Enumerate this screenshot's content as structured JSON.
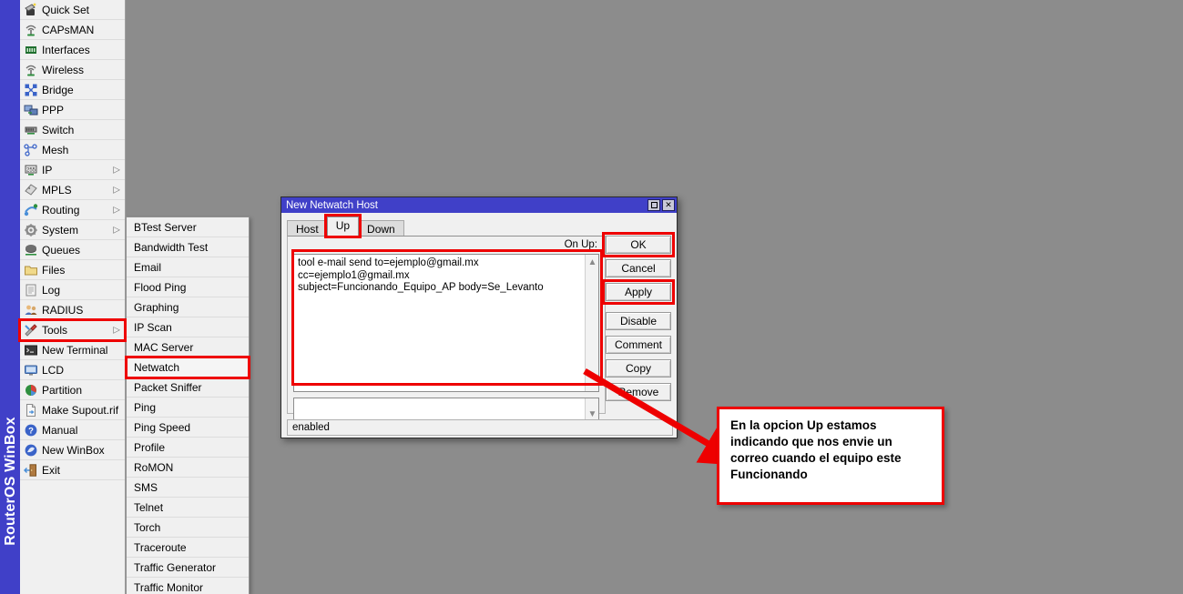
{
  "app": {
    "brand_vertical": "RouterOS WinBox",
    "brand_color": "#4040c8"
  },
  "sidebar": {
    "items": [
      {
        "label": "Quick Set",
        "icon": "quick-set-icon",
        "arrow": false
      },
      {
        "label": "CAPsMAN",
        "icon": "capsman-icon",
        "arrow": false
      },
      {
        "label": "Interfaces",
        "icon": "interfaces-icon",
        "arrow": false
      },
      {
        "label": "Wireless",
        "icon": "wireless-icon",
        "arrow": false
      },
      {
        "label": "Bridge",
        "icon": "bridge-icon",
        "arrow": false
      },
      {
        "label": "PPP",
        "icon": "ppp-icon",
        "arrow": false
      },
      {
        "label": "Switch",
        "icon": "switch-icon",
        "arrow": false
      },
      {
        "label": "Mesh",
        "icon": "mesh-icon",
        "arrow": false
      },
      {
        "label": "IP",
        "icon": "ip-icon",
        "arrow": true
      },
      {
        "label": "MPLS",
        "icon": "mpls-icon",
        "arrow": true
      },
      {
        "label": "Routing",
        "icon": "routing-icon",
        "arrow": true
      },
      {
        "label": "System",
        "icon": "system-gear-icon",
        "arrow": true
      },
      {
        "label": "Queues",
        "icon": "queues-icon",
        "arrow": false
      },
      {
        "label": "Files",
        "icon": "folder-icon",
        "arrow": false
      },
      {
        "label": "Log",
        "icon": "log-icon",
        "arrow": false
      },
      {
        "label": "RADIUS",
        "icon": "radius-users-icon",
        "arrow": false
      },
      {
        "label": "Tools",
        "icon": "tools-icon",
        "arrow": true,
        "highlighted": true
      },
      {
        "label": "New Terminal",
        "icon": "terminal-icon",
        "arrow": false
      },
      {
        "label": "LCD",
        "icon": "lcd-monitor-icon",
        "arrow": false
      },
      {
        "label": "Partition",
        "icon": "partition-pie-icon",
        "arrow": false
      },
      {
        "label": "Make Supout.rif",
        "icon": "document-out-icon",
        "arrow": false
      },
      {
        "label": "Manual",
        "icon": "help-question-icon",
        "arrow": false
      },
      {
        "label": "New WinBox",
        "icon": "new-winbox-icon",
        "arrow": false
      },
      {
        "label": "Exit",
        "icon": "exit-door-icon",
        "arrow": false
      }
    ]
  },
  "submenu": {
    "items": [
      {
        "label": "BTest Server"
      },
      {
        "label": "Bandwidth Test"
      },
      {
        "label": "Email"
      },
      {
        "label": "Flood Ping"
      },
      {
        "label": "Graphing"
      },
      {
        "label": "IP Scan"
      },
      {
        "label": "MAC Server"
      },
      {
        "label": "Netwatch",
        "highlighted": true
      },
      {
        "label": "Packet Sniffer"
      },
      {
        "label": "Ping"
      },
      {
        "label": "Ping Speed"
      },
      {
        "label": "Profile"
      },
      {
        "label": "RoMON"
      },
      {
        "label": "SMS"
      },
      {
        "label": "Telnet"
      },
      {
        "label": "Torch"
      },
      {
        "label": "Traceroute"
      },
      {
        "label": "Traffic Generator"
      },
      {
        "label": "Traffic Monitor"
      }
    ]
  },
  "dialog": {
    "title": "New Netwatch Host",
    "window_buttons": {
      "maximize": "maximize-icon",
      "close": "✕"
    },
    "tabs": [
      {
        "label": "Host",
        "active": false
      },
      {
        "label": "Up",
        "active": true,
        "highlighted": true
      },
      {
        "label": "Down",
        "active": false
      }
    ],
    "field_label": "On Up:",
    "script_value": "tool e-mail send to=ejemplo@gmail.mx cc=ejemplo1@gmail.mx\nsubject=Funcionando_Equipo_AP body=Se_Levanto",
    "buttons": [
      {
        "label": "OK",
        "highlighted": true
      },
      {
        "label": "Cancel",
        "highlighted": false
      },
      {
        "label": "Apply",
        "highlighted": true
      },
      {
        "label": "Disable",
        "highlighted": false
      },
      {
        "label": "Comment",
        "highlighted": false
      },
      {
        "label": "Copy",
        "highlighted": false
      },
      {
        "label": "Remove",
        "highlighted": false
      }
    ],
    "status": "enabled"
  },
  "annotation": {
    "text": "En la opcion Up estamos indicando que nos envie un correo cuando el equipo este Funcionando",
    "border_color": "#ee0000"
  }
}
